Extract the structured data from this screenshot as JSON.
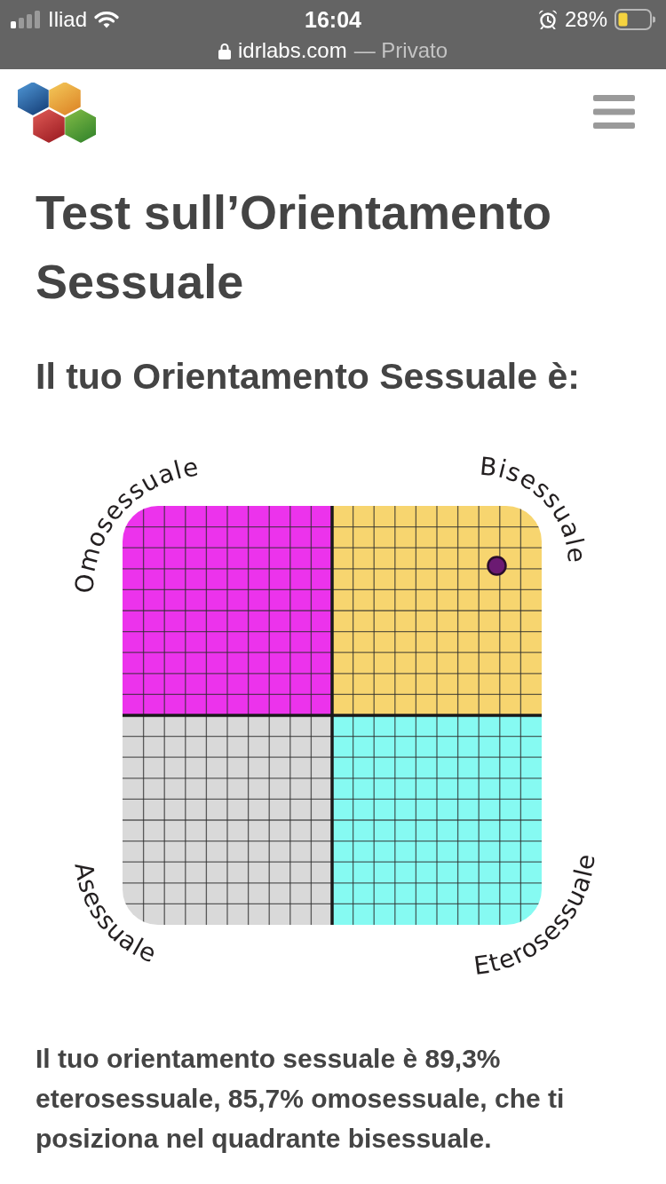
{
  "status_bar": {
    "carrier": "Iliad",
    "time": "16:04",
    "battery_percent": "28%",
    "url": "idrlabs.com",
    "browsing_mode": "— Privato"
  },
  "title": "Test sull’Orientamento Sessuale",
  "subtitle": "Il tuo Orientamento Sessuale è:",
  "quadrant_chart": {
    "quadrants": [
      {
        "label": "Omosessuale",
        "color": "#ec33ec"
      },
      {
        "label": "Bisessuale",
        "color": "#f7d56f"
      },
      {
        "label": "Asessuale",
        "color": "#d9d9d9"
      },
      {
        "label": "Eterosessuale",
        "color": "#86faf2"
      }
    ]
  },
  "result_text": "Il tuo orientamento sessuale è 89,3% eterosessuale, 85,7% omosessuale, che ti posiziona nel quadrante bisessuale."
}
